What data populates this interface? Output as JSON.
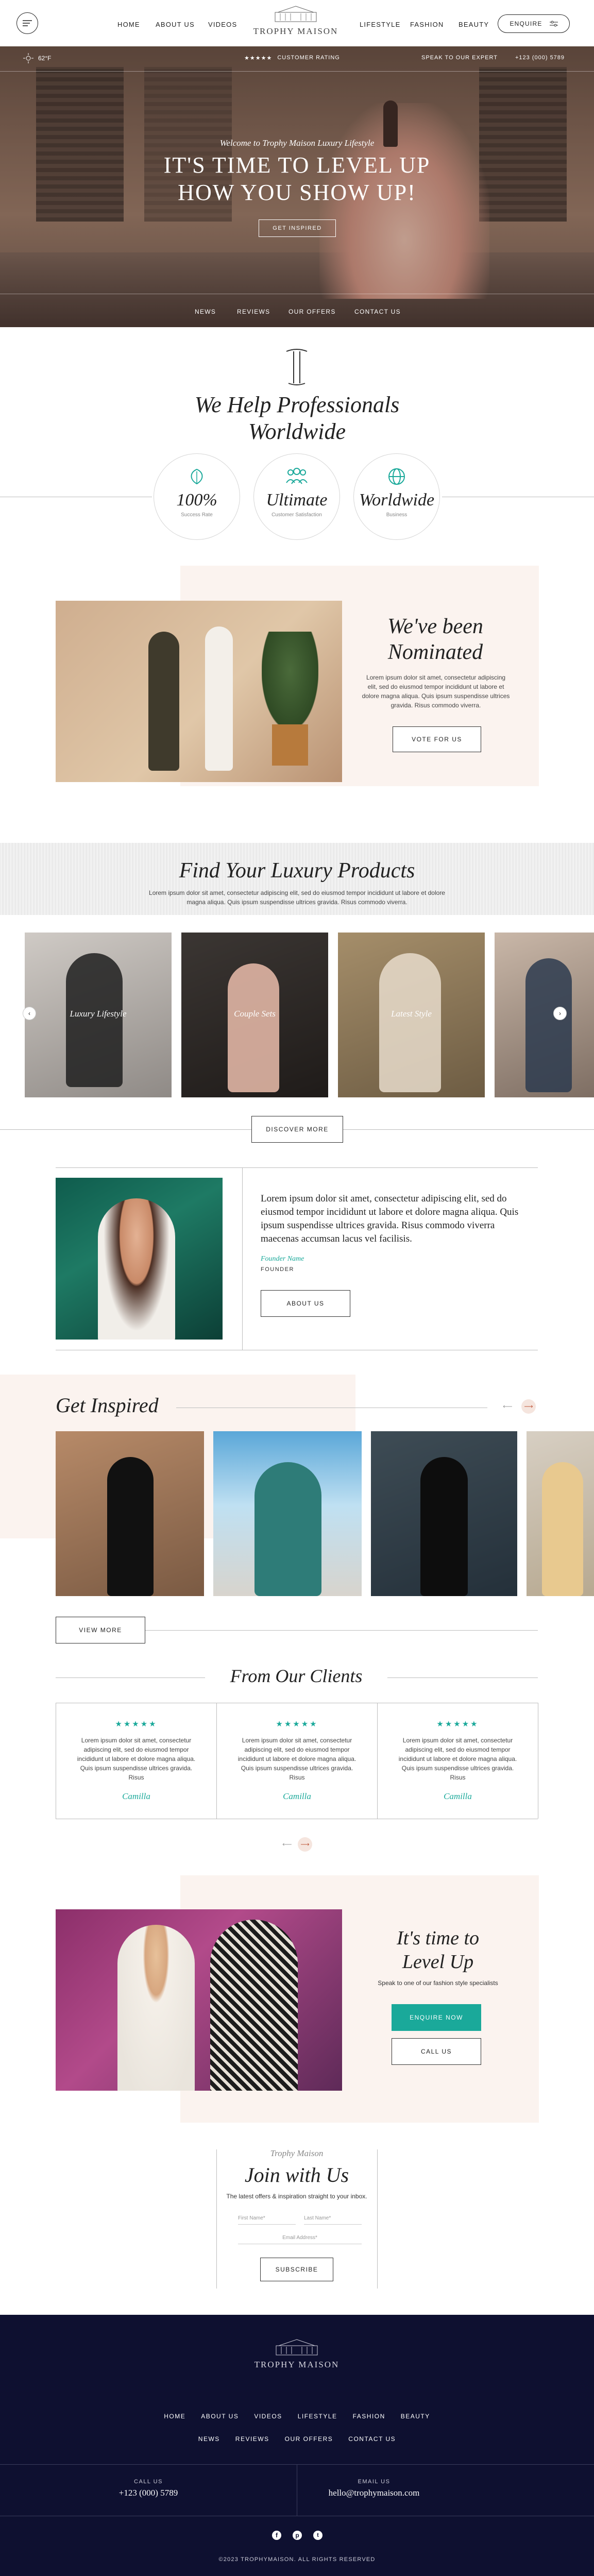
{
  "header": {
    "nav_left": [
      "HOME",
      "ABOUT US",
      "VIDEOS"
    ],
    "nav_right": [
      "LIFESTYLE",
      "FASHION",
      "BEAUTY"
    ],
    "logo": "TROPHY MAISON",
    "enquire_label": "ENQUIRE"
  },
  "hero": {
    "temp": "62°F",
    "rating_label": "CUSTOMER RATING",
    "stars": "★★★★★",
    "expert_label": "SPEAK TO OUR EXPERT",
    "phone": "+123 (000) 5789",
    "welcome": "Welcome to Trophy Maison Luxury Lifestyle",
    "headline_1": "IT'S TIME TO LEVEL UP",
    "headline_2": "HOW YOU SHOW UP!",
    "cta_label": "GET INSPIRED",
    "subnav": [
      "NEWS",
      "REVIEWS",
      "OUR OFFERS",
      "CONTACT US"
    ]
  },
  "professionals": {
    "title_1": "We Help Professionals",
    "title_2": "Worldwide",
    "stats": [
      {
        "value": "100%",
        "label": "Success Rate",
        "icon": "leaf-icon"
      },
      {
        "value": "Ultimate",
        "label": "Customer Satisfaction",
        "icon": "people-icon"
      },
      {
        "value": "Worldwide",
        "label": "Business",
        "icon": "globe-icon"
      }
    ]
  },
  "nominated": {
    "title_1": "We've been",
    "title_2": "Nominated",
    "body": "Lorem ipsum dolor sit amet, consectetur adipiscing elit, sed do eiusmod tempor incididunt ut labore et dolore magna aliqua. Quis ipsum suspendisse ultrices gravida. Risus commodo viverra.",
    "button": "VOTE FOR US"
  },
  "products": {
    "title": "Find Your Luxury Products",
    "body": "Lorem ipsum dolor sit amet, consectetur adipiscing elit, sed do eiusmod tempor incididunt ut labore et dolore magna aliqua. Quis ipsum suspendisse ultrices gravida. Risus commodo viverra.",
    "cards": [
      "Luxury Lifestyle",
      "Couple Sets",
      "Latest Style",
      ""
    ],
    "button": "DISCOVER MORE"
  },
  "founder": {
    "quote": "Lorem ipsum dolor sit amet, consectetur adipiscing elit, sed do eiusmod tempor incididunt ut labore et dolore magna aliqua. Quis ipsum suspendisse ultrices gravida. Risus commodo viverra maecenas accumsan lacus vel facilisis.",
    "signature": "Founder Name",
    "role": "FOUNDER",
    "button": "ABOUT US"
  },
  "inspired": {
    "title": "Get Inspired",
    "button": "VIEW MORE"
  },
  "clients": {
    "title": "From Our Clients",
    "testimonials": [
      {
        "stars": "★★★★★",
        "text": "Lorem ipsum dolor sit amet, consectetur adipiscing elit, sed do eiusmod tempor incididunt ut labore et dolore magna aliqua. Quis ipsum suspendisse ultrices gravida. Risus",
        "name": "Camilla"
      },
      {
        "stars": "★★★★★",
        "text": "Lorem ipsum dolor sit amet, consectetur adipiscing elit, sed do eiusmod tempor incididunt ut labore et dolore magna aliqua. Quis ipsum suspendisse ultrices gravida. Risus",
        "name": "Camilla"
      },
      {
        "stars": "★★★★★",
        "text": "Lorem ipsum dolor sit amet, consectetur adipiscing elit, sed do eiusmod tempor incididunt ut labore et dolore magna aliqua. Quis ipsum suspendisse ultrices gravida. Risus",
        "name": "Camilla"
      }
    ]
  },
  "levelup": {
    "title_1": "It's time to",
    "title_2": "Level Up",
    "body": "Speak to one of our fashion style specialists",
    "enquire": "ENQUIRE NOW",
    "call": "CALL US"
  },
  "join": {
    "brand": "Trophy Maison",
    "title": "Join with Us",
    "body": "The latest offers & inspiration straight to your inbox.",
    "first_name": "First Name*",
    "last_name": "Last Name*",
    "email": "Email Address*",
    "button": "SUBSCRIBE"
  },
  "footer": {
    "logo": "TROPHY MAISON",
    "nav_row1": [
      "HOME",
      "ABOUT US",
      "VIDEOS",
      "LIFESTYLE",
      "FASHION",
      "BEAUTY"
    ],
    "nav_row2": [
      "NEWS",
      "REVIEWS",
      "OUR OFFERS",
      "CONTACT US"
    ],
    "call_label": "CALL US",
    "call_value": "+123 (000) 5789",
    "email_label": "EMAIL US",
    "email_value": "hello@trophymaison.com",
    "copyright": "©2023 TROPHYMAISON. ALL RIGHTS RESERVED"
  },
  "colors": {
    "accent": "#1aa99a",
    "footer": "#0e1030",
    "blush": "#fbf3ef"
  }
}
